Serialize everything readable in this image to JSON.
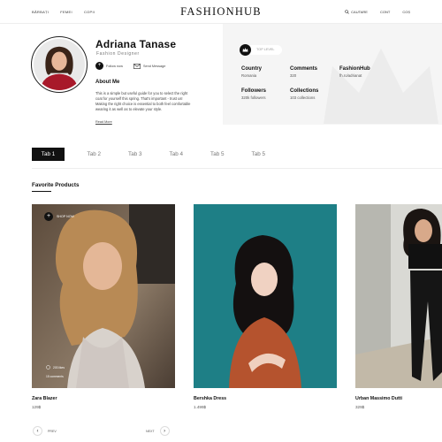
{
  "header": {
    "nav_left": [
      "BĂRBAȚI",
      "FEMEI",
      "COPII"
    ],
    "logo": "FASHIONHUB",
    "search_label": "CAUTARE",
    "nav_right": [
      "CONT",
      "COȘ"
    ]
  },
  "profile": {
    "name": "Adriana Tanase",
    "role": "Fashion Designer",
    "follow_label": "Follow now",
    "message_label": "Send Message",
    "about_title": "About Me",
    "about_text": "This is a simple but useful guide for you to select the right coat for yourself this spring. That's important - trust us! Making the right choice is essential to both feel comfortable wearing it as well as to elevate your style.",
    "read_more": "Read More"
  },
  "stats": {
    "badge": "TOP LEVEL",
    "items": [
      {
        "label": "Country",
        "value": "Romania"
      },
      {
        "label": "Comments",
        "value": "320"
      },
      {
        "label": "FashionHub",
        "value": "fh.ro/adrianat"
      },
      {
        "label": "Followers",
        "value": "320k followers"
      },
      {
        "label": "Collections",
        "value": "103 collections"
      }
    ]
  },
  "tabs": [
    "Tab 1",
    "Tab 2",
    "Tab 3",
    "Tab 4",
    "Tab 5",
    "Tab 5"
  ],
  "favorites": {
    "title": "Favorite Products",
    "shop_now": "SHOP NOW",
    "likes": "203 likes",
    "comments": "15 comments",
    "products": [
      {
        "name": "Zara Blazer",
        "price": "129$"
      },
      {
        "name": "Bershka Dress",
        "price": "1.499$"
      },
      {
        "name": "Urban Massimo Dutti",
        "price": "329$"
      }
    ]
  },
  "pager": {
    "prev": "PREV",
    "next": "NEXT"
  },
  "colors": {
    "accent": "#111111",
    "panel": "#f5f5f5",
    "teal": "#1e7f86"
  }
}
